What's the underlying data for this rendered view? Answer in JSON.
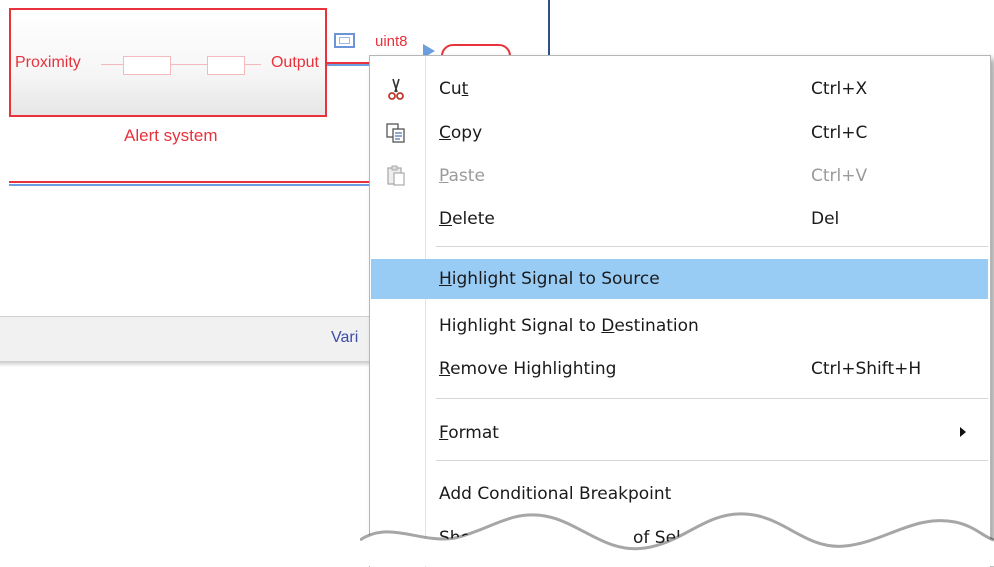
{
  "canvas": {
    "block": {
      "input_label": "Proximity",
      "output_label": "Output",
      "name": "Alert system"
    },
    "signal": {
      "data_type": "uint8"
    },
    "status_bar": {
      "text": "Vari"
    }
  },
  "context_menu": {
    "items": [
      {
        "label": "Cut",
        "mnemonic": "t",
        "shortcut": "Ctrl+X",
        "icon": "scissors-icon",
        "enabled": true
      },
      {
        "label": "Copy",
        "mnemonic": "C",
        "shortcut": "Ctrl+C",
        "icon": "copy-icon",
        "enabled": true
      },
      {
        "label": "Paste",
        "mnemonic": "P",
        "shortcut": "Ctrl+V",
        "icon": "paste-icon",
        "enabled": false
      },
      {
        "label": "Delete",
        "mnemonic": "D",
        "shortcut": "Del",
        "icon": "",
        "enabled": true
      },
      {
        "label": "Highlight Signal to Source",
        "mnemonic": "H",
        "shortcut": "",
        "highlighted": true,
        "enabled": true
      },
      {
        "label": "Highlight Signal to Destination",
        "mnemonic": "D",
        "shortcut": "",
        "enabled": true
      },
      {
        "label": "Remove Highlighting",
        "mnemonic": "R",
        "shortcut": "Ctrl+Shift+H",
        "enabled": true
      },
      {
        "label": "Format",
        "mnemonic": "F",
        "shortcut": "",
        "submenu": true,
        "enabled": true
      },
      {
        "label": "Add Conditional Breakpoint",
        "mnemonic": "",
        "shortcut": "",
        "enabled": true
      },
      {
        "label": "Show V",
        "label_tail": "of Selected P",
        "mnemonic": "",
        "shortcut": "",
        "enabled": true,
        "truncated": true
      }
    ]
  },
  "colors": {
    "highlight": "#99ccf5",
    "block_red": "#e8323c",
    "signal_blue": "#6aa0e0",
    "disabled_text": "#9a9a9a"
  }
}
